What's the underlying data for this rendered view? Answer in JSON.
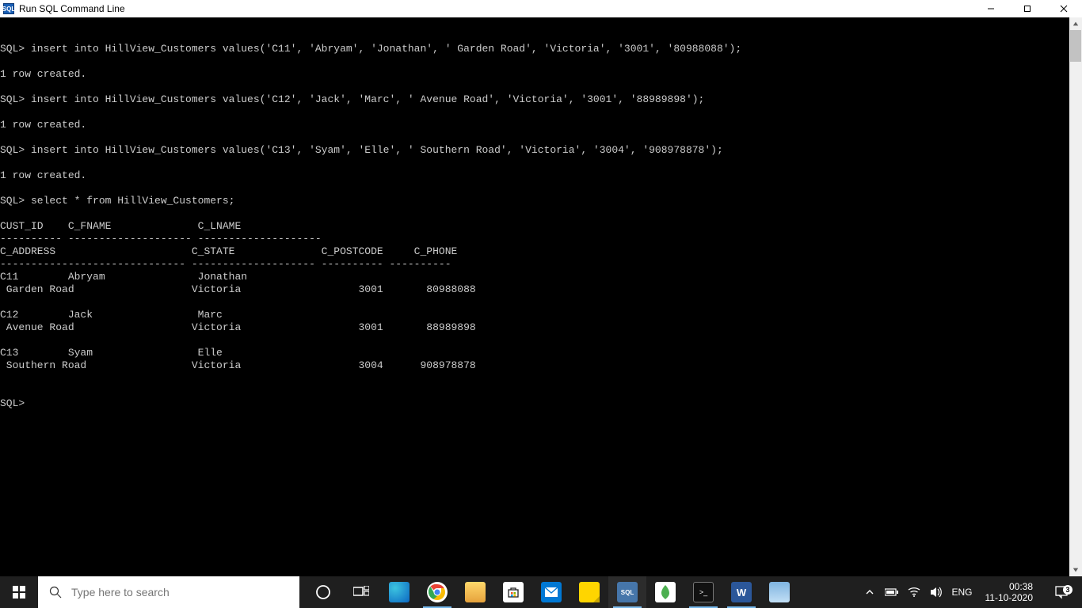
{
  "window": {
    "title": "Run SQL Command Line"
  },
  "terminal": {
    "lines": [
      "SQL> insert into HillView_Customers values('C11', 'Abryam', 'Jonathan', ' Garden Road', 'Victoria', '3001', '80988088');",
      "",
      "1 row created.",
      "",
      "SQL> insert into HillView_Customers values('C12', 'Jack', 'Marc', ' Avenue Road', 'Victoria', '3001', '88989898');",
      "",
      "1 row created.",
      "",
      "SQL> insert into HillView_Customers values('C13', 'Syam', 'Elle', ' Southern Road', 'Victoria', '3004', '908978878');",
      "",
      "1 row created.",
      "",
      "SQL> select * from HillView_Customers;",
      "",
      "CUST_ID    C_FNAME              C_LNAME",
      "---------- -------------------- --------------------",
      "C_ADDRESS                      C_STATE              C_POSTCODE     C_PHONE",
      "------------------------------ -------------------- ---------- ----------",
      "C11        Abryam               Jonathan",
      " Garden Road                   Victoria                   3001       80988088",
      "",
      "C12        Jack                 Marc",
      " Avenue Road                   Victoria                   3001       88989898",
      "",
      "C13        Syam                 Elle",
      " Southern Road                 Victoria                   3004      908978878",
      "",
      "",
      "SQL>"
    ]
  },
  "taskbar": {
    "search_placeholder": "Type here to search",
    "tray": {
      "language": "ENG",
      "time": "00:38",
      "date": "11-10-2020",
      "notif_count": "3"
    }
  }
}
